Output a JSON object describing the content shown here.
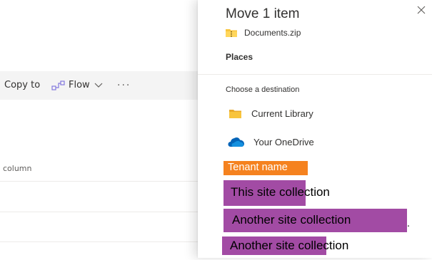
{
  "background": {
    "commandbar": {
      "copy_label": "Copy to",
      "flow_label": "Flow",
      "more_label": "···"
    },
    "column_header": "column"
  },
  "panel": {
    "title": "Move 1 item",
    "file_name": "Documents.zip",
    "section_title": "Places",
    "choose_label": "Choose a destination",
    "destinations": [
      {
        "label": "Current Library",
        "icon": "folder-icon"
      },
      {
        "label": "Your OneDrive",
        "icon": "onedrive-icon"
      }
    ]
  },
  "overlays": {
    "tenant": {
      "label": "Tenant name",
      "color": "#f5821f"
    },
    "sites": [
      {
        "label": "This site collection",
        "color": "#a24ba4"
      },
      {
        "label": "Another site collection",
        "color": "#a24ba4",
        "trailing": "."
      },
      {
        "label": "Another site collection",
        "color": "#a24ba4"
      }
    ]
  },
  "colors": {
    "folder": "#f8c43c",
    "onedrive": "#0364b8",
    "commandbar_bg": "#f4f4f4",
    "flow_icon": "#8378de"
  }
}
